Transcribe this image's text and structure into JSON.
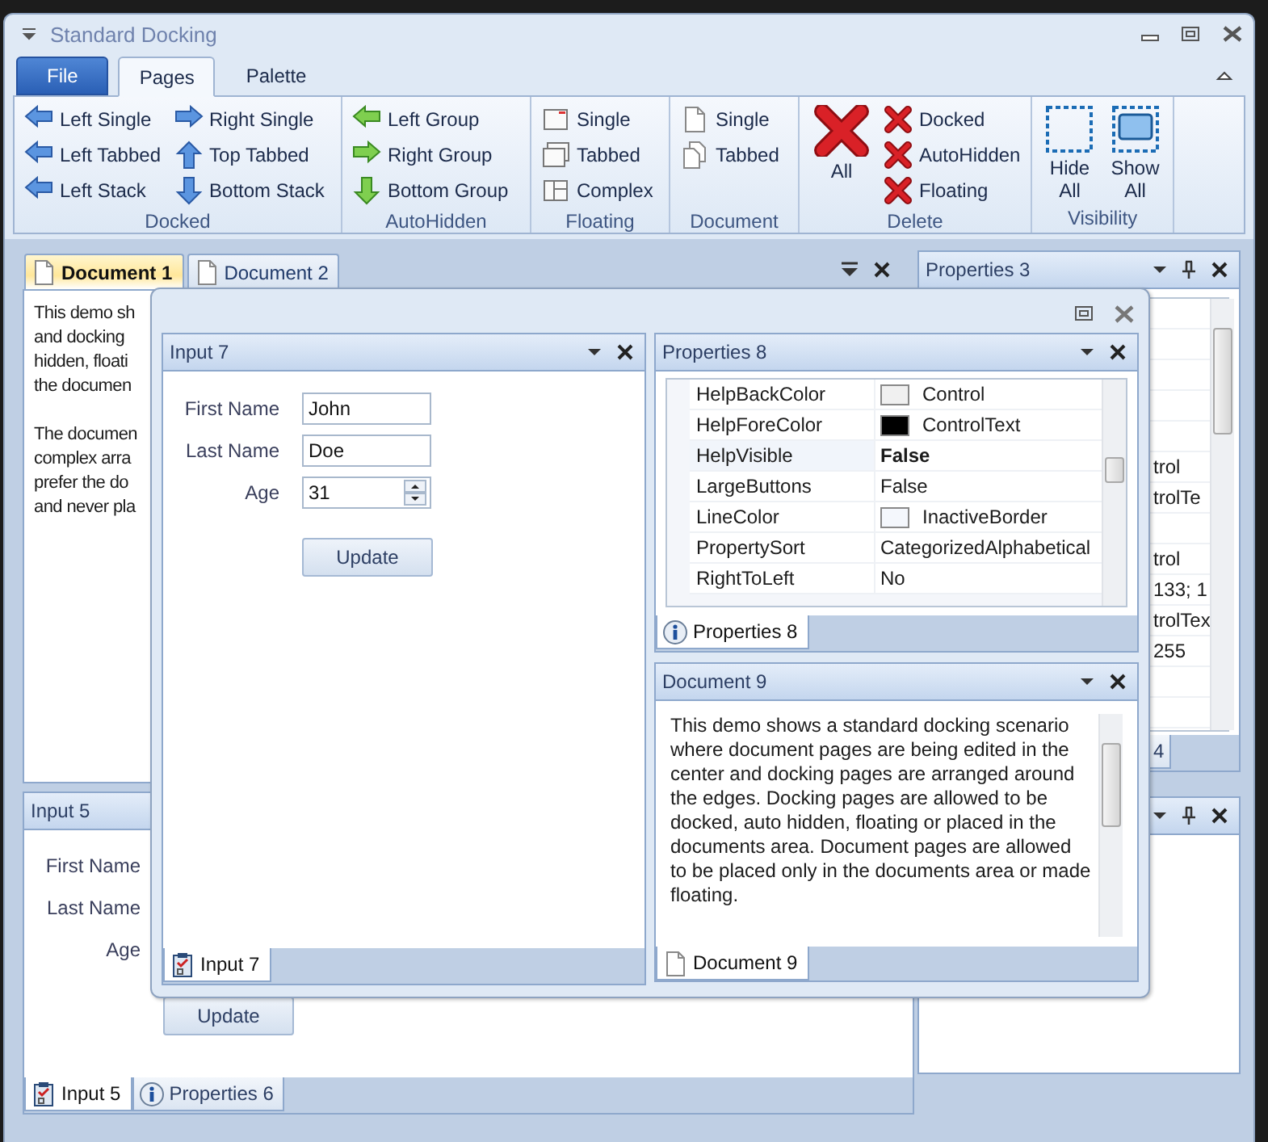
{
  "window": {
    "title": "Standard Docking"
  },
  "ribbon": {
    "tabs": [
      {
        "label": "File",
        "kind": "file",
        "selected": false
      },
      {
        "label": "Pages",
        "kind": "tab",
        "selected": true
      },
      {
        "label": "Palette",
        "kind": "tab",
        "selected": false
      }
    ],
    "groups": [
      {
        "title": "Docked",
        "kind": "docked",
        "items": [
          {
            "label": "Left Single",
            "kind": "left"
          },
          {
            "label": "Left Tabbed",
            "kind": "left"
          },
          {
            "label": "Left Stack",
            "kind": "left"
          },
          {
            "label": "Right Single",
            "kind": "right"
          },
          {
            "label": "Top Tabbed",
            "kind": "up"
          },
          {
            "label": "Bottom Stack",
            "kind": "down"
          }
        ]
      },
      {
        "title": "AutoHidden",
        "kind": "autohidden",
        "items": [
          {
            "label": "Left Group",
            "kind": "left"
          },
          {
            "label": "Right Group",
            "kind": "right"
          },
          {
            "label": "Bottom Group",
            "kind": "down"
          }
        ]
      },
      {
        "title": "Floating",
        "kind": "plain",
        "items": [
          {
            "label": "Single",
            "kind": "window"
          },
          {
            "label": "Tabbed",
            "kind": "windows"
          },
          {
            "label": "Complex",
            "kind": "split"
          }
        ]
      },
      {
        "title": "Document",
        "kind": "plain",
        "items": [
          {
            "label": "Single",
            "kind": "page"
          },
          {
            "label": "Tabbed",
            "kind": "pages"
          }
        ]
      },
      {
        "title": "Delete",
        "kind": "plain",
        "items": [
          {
            "label": "All",
            "kind": "delete-large"
          },
          {
            "label": "Docked",
            "kind": "delete"
          },
          {
            "label": "AutoHidden",
            "kind": "delete"
          },
          {
            "label": "Floating",
            "kind": "delete"
          }
        ]
      },
      {
        "title": "Visibility",
        "kind": "plain",
        "items": [
          {
            "label": "Hide All",
            "kind": "hide"
          },
          {
            "label": "Show All",
            "kind": "show"
          }
        ]
      }
    ]
  },
  "documents": {
    "tabs": [
      {
        "label": "Document 1",
        "selected": true
      },
      {
        "label": "Document 2",
        "selected": false
      }
    ],
    "paragraphs": [
      [
        "This demo sh",
        "and docking",
        "hidden, floati",
        "the documen"
      ],
      [
        "The documen",
        "complex arra",
        "prefer the do",
        "and never pla"
      ]
    ]
  },
  "input_5": {
    "title": "Input 5",
    "labels": [
      "First Name",
      "Last Name",
      "Age"
    ],
    "button": "Update",
    "tabs": [
      {
        "label": "Input 5",
        "kind": "input",
        "selected": true
      },
      {
        "label": "Properties 6",
        "kind": "info",
        "selected": false
      }
    ]
  },
  "properties_3": {
    "title": "Properties 3",
    "value_groups": [
      [
        "trol",
        "trolTe"
      ],
      [
        "trol",
        "133; 1",
        "trolTex",
        "255"
      ]
    ],
    "tabs": [
      {
        "label": "4",
        "selected": false
      }
    ]
  },
  "floating_window": {
    "input_7": {
      "title": "Input 7",
      "fields": [
        {
          "label": "First Name",
          "value": "John",
          "kind": "text"
        },
        {
          "label": "Last Name",
          "value": "Doe",
          "kind": "text"
        },
        {
          "label": "Age",
          "value": "31",
          "kind": "spin"
        }
      ],
      "button": "Update",
      "tabs": [
        {
          "label": "Input 7",
          "kind": "input",
          "selected": true
        }
      ]
    },
    "properties_8": {
      "title": "Properties 8",
      "rows": [
        {
          "name": "HelpBackColor",
          "value": "Control",
          "color": "#f0f0f0",
          "selected": false,
          "modified": false
        },
        {
          "name": "HelpForeColor",
          "value": "ControlText",
          "color": "#000000",
          "selected": false,
          "modified": false
        },
        {
          "name": "HelpVisible",
          "value": "False",
          "selected": true,
          "modified": true
        },
        {
          "name": "LargeButtons",
          "value": "False",
          "selected": false,
          "modified": false
        },
        {
          "name": "LineColor",
          "value": "InactiveBorder",
          "color": "#f4f7fc",
          "selected": false,
          "modified": false
        },
        {
          "name": "PropertySort",
          "value": "CategorizedAlphabetical",
          "selected": false,
          "modified": false
        },
        {
          "name": "RightToLeft",
          "value": "No",
          "selected": false,
          "modified": false
        }
      ],
      "tabs": [
        {
          "label": "Properties 8",
          "kind": "info",
          "selected": true
        }
      ]
    },
    "document_9": {
      "title": "Document 9",
      "text": "This demo shows a standard docking scenario where document pages are being edited in the center and docking pages are arranged around the edges. Docking pages are allowed to be docked, auto hidden, floating or placed in the documents area. Document pages are allowed to be placed only in the documents area or made floating.",
      "tabs": [
        {
          "label": "Document 9",
          "kind": "page",
          "selected": true
        }
      ]
    }
  }
}
